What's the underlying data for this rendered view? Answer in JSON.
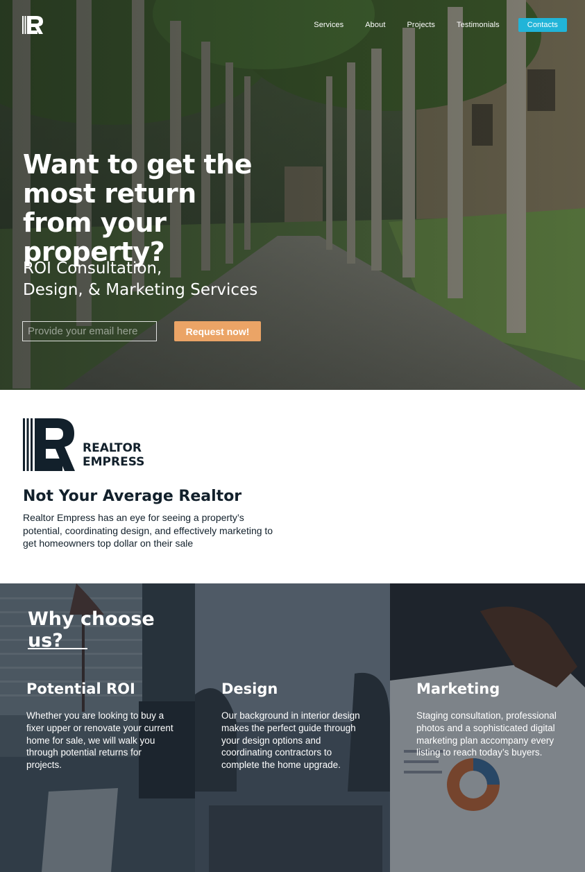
{
  "brand": {
    "name_line1": "REALTOR",
    "name_line2": "EMPRESS",
    "navy": "#12202b",
    "accent_cyan": "#21b4d8",
    "accent_orange": "#eba466"
  },
  "nav": {
    "items": [
      {
        "label": "Services"
      },
      {
        "label": "About"
      },
      {
        "label": "Projects"
      },
      {
        "label": "Testimonials"
      }
    ],
    "contact_label": "Contacts"
  },
  "hero": {
    "title": "Want to get the most return from your property?",
    "subtitle_line1": "ROI Consultation,",
    "subtitle_line2": "Design, & Marketing Services",
    "email_placeholder": "Provide your email here",
    "email_value": "",
    "cta_label": "Request now!"
  },
  "about": {
    "heading": "Not Your Average Realtor",
    "text": "Realtor Empress has an eye for seeing a property’s potential, coordinating design, and effectively marketing to get homeowners top dollar on their sale"
  },
  "why": {
    "title": "Why choose us?",
    "columns": [
      {
        "title": "Potential ROI",
        "text": "Whether you are looking to buy a fixer upper or renovate your current home for sale, we will walk you through potential returns for projects."
      },
      {
        "title": "Design",
        "text": "Our background in interior design makes the perfect guide through your design options and coordinating contractors to complete the home upgrade."
      },
      {
        "title": "Marketing",
        "text": "Staging consultation, professional photos and a sophisticated digital marketing plan accompany every listing to reach today’s buyers."
      }
    ]
  }
}
